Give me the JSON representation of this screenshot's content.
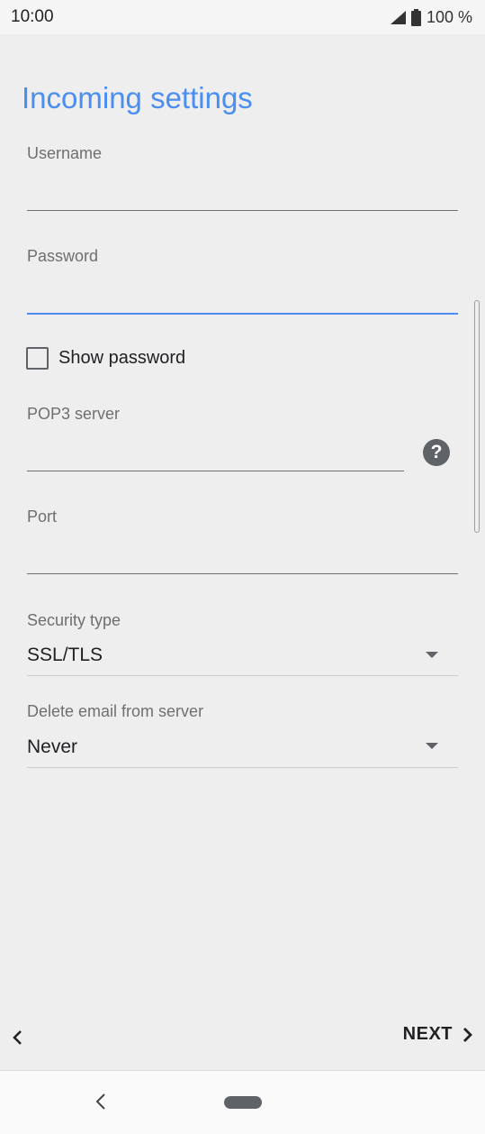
{
  "status_bar": {
    "time": "10:00",
    "battery": "100 %",
    "signal_icon": "signal-icon",
    "battery_icon": "battery-icon"
  },
  "page": {
    "title": "Incoming settings"
  },
  "form": {
    "username": {
      "label": "Username",
      "value": ""
    },
    "password": {
      "label": "Password",
      "value": "",
      "focused": true
    },
    "show_password": {
      "label": "Show password",
      "checked": false
    },
    "pop3_server": {
      "label": "POP3 server",
      "value": "",
      "help_icon": "question-mark-icon"
    },
    "port": {
      "label": "Port",
      "value": ""
    },
    "security_type": {
      "label": "Security type",
      "value": "SSL/TLS"
    },
    "delete_email": {
      "label": "Delete email from server",
      "value": "Never"
    }
  },
  "footer": {
    "next_label": "NEXT",
    "back_icon": "chevron-left-icon",
    "next_icon": "chevron-right-icon"
  },
  "system_nav": {
    "back_icon": "system-back-icon",
    "home_icon": "home-pill-icon"
  },
  "colors": {
    "accent": "#4a8ef0",
    "background": "#eeeeee",
    "text": "#202124",
    "label": "#6f6f6f"
  }
}
